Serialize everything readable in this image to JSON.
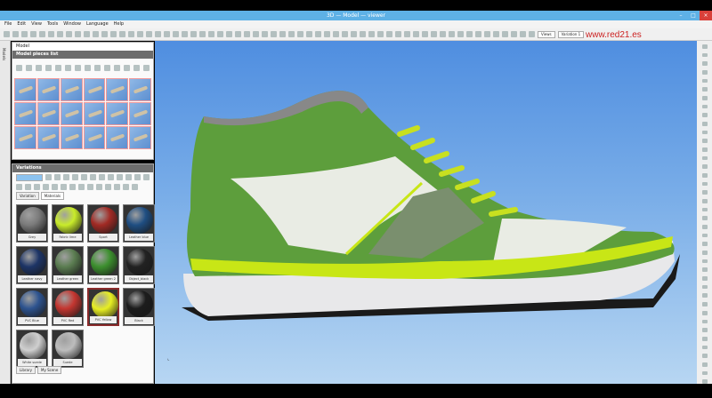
{
  "window": {
    "title": "3D — Model — viewer"
  },
  "menu": [
    "File",
    "Edit",
    "View",
    "Tools",
    "Window",
    "Language",
    "Help"
  ],
  "toolbar": {
    "views_label": "Views",
    "variation_select": "Variation 1"
  },
  "brand": "www.red21.es",
  "left_strip": {
    "label": "Models"
  },
  "model_panel": {
    "title": "Model",
    "pieces_header": "Model pieces list",
    "piece_count": 18
  },
  "variations_panel": {
    "title": "Variations",
    "search_value": "",
    "tabs": [
      {
        "label": "Variation",
        "active": false
      },
      {
        "label": "Materials",
        "active": true
      }
    ],
    "materials": [
      {
        "label": "Grey",
        "color": "#7b7b7b"
      },
      {
        "label": "Fabric lime",
        "color": "#c9ec2a"
      },
      {
        "label": "Sport",
        "color": "#a12a24"
      },
      {
        "label": "Leather blue",
        "color": "#1f4e82"
      },
      {
        "label": "Leather navy",
        "color": "#1d3466"
      },
      {
        "label": "Leather green",
        "color": "#5b7d51"
      },
      {
        "label": "Leather green 2",
        "color": "#3c8f2e"
      },
      {
        "label": "Object_black",
        "color": "#222222"
      },
      {
        "label": "PVC Blue",
        "color": "#2d538f"
      },
      {
        "label": "PVC Red",
        "color": "#c43630"
      },
      {
        "label": "PVC Yellow",
        "color": "#e7ee22",
        "selected": true
      },
      {
        "label": "Black",
        "color": "#1c1c1c"
      },
      {
        "label": "White suede",
        "color": "#cfcfcf"
      },
      {
        "label": "Suede",
        "color": "#bdbdbd"
      }
    ],
    "bottom_tabs": [
      "Library",
      "My Scene"
    ]
  },
  "colors": {
    "upper": "#5d9e3c",
    "mesh": "#e9ece4",
    "accent": "#c8e616",
    "sole": "#e8e8ea",
    "outsole": "#1a1a1a",
    "lace": "#c8e020"
  }
}
